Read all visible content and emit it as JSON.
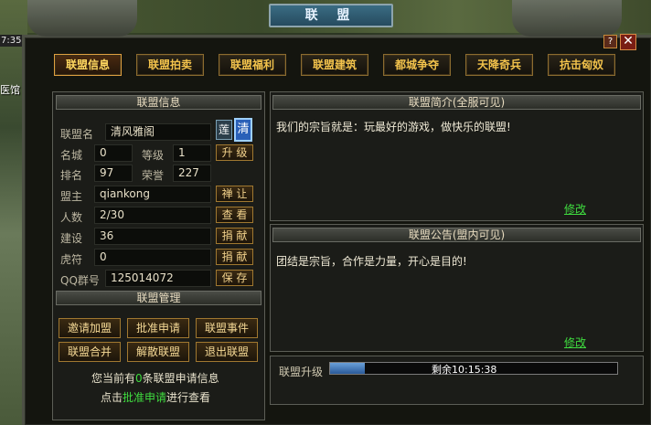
{
  "clock": "7:35",
  "side_label": "医馆",
  "window": {
    "title": "联 盟",
    "help": "?",
    "close": "✕"
  },
  "tabs": [
    {
      "label": "联盟信息"
    },
    {
      "label": "联盟拍卖"
    },
    {
      "label": "联盟福利"
    },
    {
      "label": "联盟建筑"
    },
    {
      "label": "都城争夺"
    },
    {
      "label": "天降奇兵"
    },
    {
      "label": "抗击匈奴"
    }
  ],
  "info": {
    "header": "联盟信息",
    "name_label": "联盟名",
    "name_value": "清风雅阁",
    "name_badge_1": "莲",
    "name_badge_2": "清",
    "city_label": "名城",
    "city_value": "0",
    "level_label": "等级",
    "level_value": "1",
    "upgrade_btn": "升 级",
    "rank_label": "排名",
    "rank_value": "97",
    "honor_label": "荣誉",
    "honor_value": "227",
    "leader_label": "盟主",
    "leader_value": "qiankong",
    "abdicate_btn": "禅 让",
    "members_label": "人数",
    "members_value": "2/30",
    "view_btn": "查 看",
    "build_label": "建设",
    "build_value": "36",
    "donate_btn_1": "捐 献",
    "tiger_label": "虎符",
    "tiger_value": "0",
    "donate_btn_2": "捐 献",
    "qq_label": "QQ群号",
    "qq_value": "125014072",
    "save_btn": "保 存"
  },
  "manage": {
    "header": "联盟管理",
    "buttons": [
      "邀请加盟",
      "批准申请",
      "联盟事件",
      "联盟合并",
      "解散联盟",
      "退出联盟"
    ],
    "notice_prefix": "您当前有",
    "notice_count": "0",
    "notice_suffix": "条联盟申请信息",
    "hint_prefix": "点击",
    "hint_link": "批准申请",
    "hint_suffix": "进行查看"
  },
  "intro": {
    "header": "联盟简介(全服可见)",
    "text": "我们的宗旨就是：玩最好的游戏，做快乐的联盟!",
    "edit": "修改"
  },
  "notice": {
    "header": "联盟公告(盟内可见)",
    "text": "团结是宗旨，合作是力量，开心是目的!",
    "edit": "修改"
  },
  "upgrade": {
    "label": "联盟升级",
    "progress": 0.12,
    "remaining": "剩余10:15:38"
  },
  "colors": {
    "accent_gold": "#f3c34c",
    "link_green": "#3fdc3f",
    "title_blue": "#2e5a70"
  }
}
